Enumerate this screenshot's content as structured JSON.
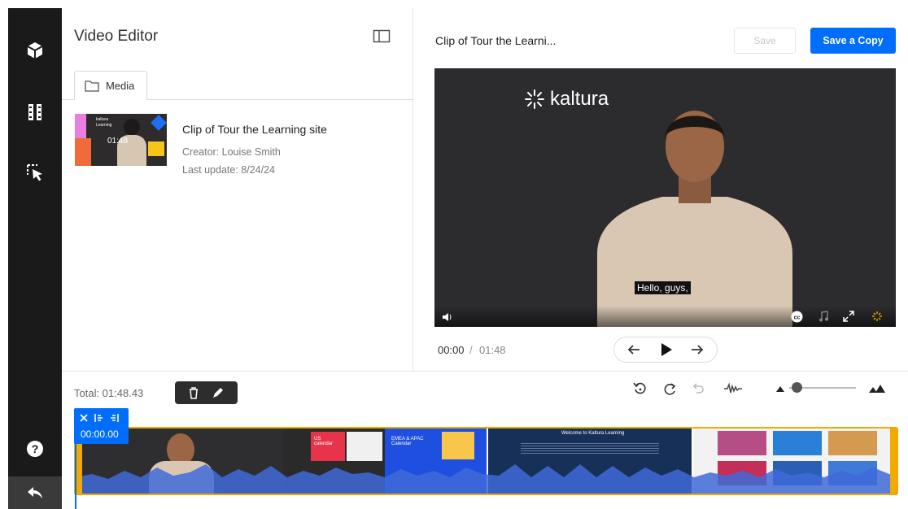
{
  "editor": {
    "title": "Video Editor",
    "media_tab_label": "Media"
  },
  "entry": {
    "title": "Clip of Tour the Learning site",
    "creator": "Creator: Louise Smith",
    "last_update": "Last update: 8/24/24",
    "thumb_duration": "01:48",
    "thumb_brand": "kaltura",
    "thumb_subtitle": "Learning"
  },
  "player": {
    "clip_title": "Clip of Tour the Learni...",
    "save_label": "Save",
    "save_copy_label": "Save a Copy",
    "watermark": "kaltura",
    "caption": "Hello, guys,",
    "current_time": "00:00",
    "separator": "/",
    "total_time": "01:48"
  },
  "timeline": {
    "total_label": "Total: 01:48.43",
    "playhead_time": "00:00.00",
    "frames": {
      "us_calendar": "US calendar",
      "emea_calendar": "EMEA & APAC Calendar",
      "welcome": "Welcome to Kaltura Learning"
    }
  },
  "colors": {
    "accent_blue": "#006efa",
    "timeline_border": "#f2a900",
    "rail_bg": "#1a1a1a",
    "player_bg": "#2c2c2e",
    "waveform": "#3f6ad8"
  },
  "icons": {
    "rail": [
      "cube-icon",
      "film-strip-icon",
      "cursor-select-icon",
      "help-icon",
      "back-arrow-icon"
    ],
    "toolbar": [
      "reset-icon",
      "redo-icon",
      "undo-icon",
      "waveform-icon",
      "zoom-out-icon",
      "zoom-in-icon"
    ]
  }
}
